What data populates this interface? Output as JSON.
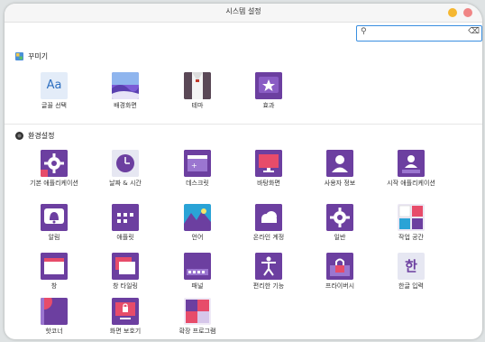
{
  "window": {
    "title": "시스템 설정"
  },
  "search": {
    "value": "",
    "placeholder": ""
  },
  "colors": {
    "accent": "#3a8fe0",
    "icon_purple": "#6c3fa0",
    "close_dot": "#f08585",
    "min_dot": "#f5b731"
  },
  "sections": [
    {
      "title": "꾸미기",
      "icon": "palette-icon",
      "items": [
        {
          "label": "글꼴 선택",
          "icon": "font-icon"
        },
        {
          "label": "배경화면",
          "icon": "wallpaper-icon"
        },
        {
          "label": "테마",
          "icon": "theme-icon"
        },
        {
          "label": "효과",
          "icon": "effects-star-icon"
        }
      ]
    },
    {
      "title": "환경설정",
      "icon": "settings-globe-icon",
      "items": [
        {
          "label": "기본 애플리케이션",
          "icon": "default-apps-gear-icon"
        },
        {
          "label": "날짜 & 시간",
          "icon": "clock-icon"
        },
        {
          "label": "데스크릿",
          "icon": "desklet-icon"
        },
        {
          "label": "바탕화면",
          "icon": "desktop-monitor-icon"
        },
        {
          "label": "사용자 정보",
          "icon": "user-icon"
        },
        {
          "label": "시작 애플리케이션",
          "icon": "startup-apps-icon"
        },
        {
          "label": "알림",
          "icon": "bell-icon"
        },
        {
          "label": "애플릿",
          "icon": "applet-grid-icon"
        },
        {
          "label": "언어",
          "icon": "language-globe-icon"
        },
        {
          "label": "온라인 계정",
          "icon": "cloud-icon"
        },
        {
          "label": "일반",
          "icon": "gear-icon"
        },
        {
          "label": "작업 공간",
          "icon": "workspace-icon"
        },
        {
          "label": "창",
          "icon": "window-icon"
        },
        {
          "label": "창 타일링",
          "icon": "window-tiling-icon"
        },
        {
          "label": "패널",
          "icon": "panel-icon"
        },
        {
          "label": "편리한 기능",
          "icon": "accessibility-icon"
        },
        {
          "label": "프라이버시",
          "icon": "privacy-lock-icon"
        },
        {
          "label": "한글 입력",
          "icon": "hangul-input-icon"
        },
        {
          "label": "핫코너",
          "icon": "hot-corner-icon"
        },
        {
          "label": "화면 보호기",
          "icon": "screensaver-lock-icon"
        },
        {
          "label": "확장 프로그램",
          "icon": "extension-puzzle-icon"
        }
      ]
    }
  ],
  "glyphs": {
    "font_icon": "Aa",
    "hangul_icon": "한",
    "search_icon": "⚲",
    "clear_icon": "⌫"
  }
}
